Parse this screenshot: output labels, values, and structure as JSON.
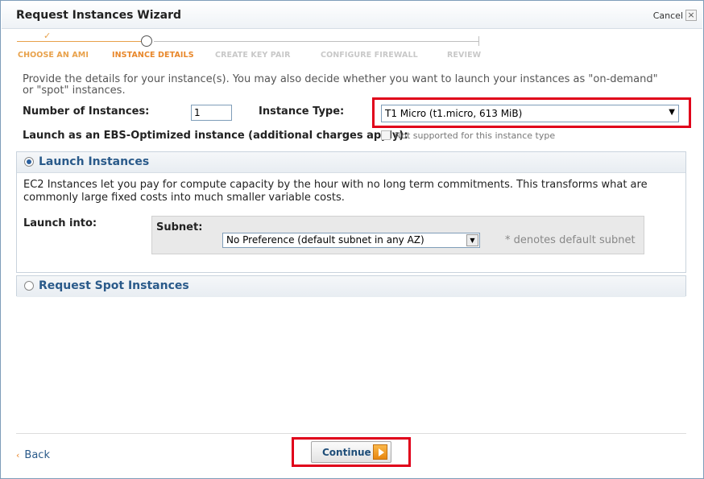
{
  "dialog": {
    "title": "Request Instances Wizard",
    "cancel_label": "Cancel",
    "close_glyph": "×"
  },
  "steps": [
    {
      "label": "CHOOSE AN AMI",
      "state": "done"
    },
    {
      "label": "INSTANCE DETAILS",
      "state": "current"
    },
    {
      "label": "CREATE KEY PAIR",
      "state": "todo"
    },
    {
      "label": "CONFIGURE FIREWALL",
      "state": "todo"
    },
    {
      "label": "REVIEW",
      "state": "todo"
    }
  ],
  "step_check_glyph": "✓",
  "intro_text": "Provide the details for your instance(s). You may also decide whether you want to launch your instances as \"on-demand\" or \"spot\" instances.",
  "form": {
    "num_instances_label": "Number of Instances:",
    "num_instances_value": "1",
    "instance_type_label": "Instance Type:",
    "instance_type_value": "T1 Micro (t1.micro, 613 MiB)",
    "ebs_label": "Launch as an EBS-Optimized instance (additional charges apply):",
    "ebs_checked": false,
    "ebs_note": "Not supported for this instance type"
  },
  "launch_panel": {
    "title": "Launch Instances",
    "selected": true,
    "description": "EC2 Instances let you pay for compute capacity by the hour with no long term commitments. This transforms what are commonly large fixed costs into much smaller variable costs.",
    "launch_into_label": "Launch into:",
    "subnet_label": "Subnet:",
    "subnet_value": "No Preference (default subnet in any AZ)",
    "subnet_hint": "* denotes default subnet"
  },
  "spot_panel": {
    "title": "Request Spot Instances",
    "selected": false
  },
  "footer": {
    "back_label": "Back",
    "back_glyph": "‹",
    "continue_label": "Continue"
  },
  "colors": {
    "highlight": "#e0001a",
    "accent_orange": "#e8872a",
    "link_blue": "#2a5a8a"
  }
}
